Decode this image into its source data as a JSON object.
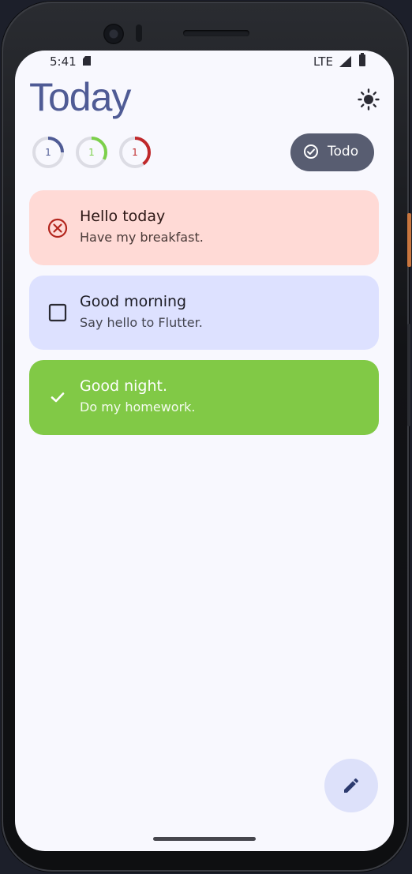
{
  "status_bar": {
    "time": "5:41",
    "network": "LTE"
  },
  "header": {
    "title": "Today"
  },
  "progress_rings": [
    {
      "value": "1",
      "color": "#4f5b95",
      "fraction": 0.25
    },
    {
      "value": "1",
      "color": "#7cd04a",
      "fraction": 0.33
    },
    {
      "value": "1",
      "color": "#c0282a",
      "fraction": 0.4
    }
  ],
  "filter_button": {
    "label": "Todo",
    "icon": "check-circle-icon"
  },
  "tasks": [
    {
      "title": "Hello today",
      "subtitle": "Have my breakfast.",
      "state": "failed",
      "icon": "cancel-icon",
      "bg": "#ffdad6"
    },
    {
      "title": "Good morning",
      "subtitle": "Say hello to Flutter.",
      "state": "pending",
      "icon": "checkbox-empty-icon",
      "bg": "#dde1ff"
    },
    {
      "title": "Good night.",
      "subtitle": "Do my homework.",
      "state": "done",
      "icon": "checkmark-icon",
      "bg": "#81c946"
    }
  ],
  "fab": {
    "icon": "pencil-icon"
  }
}
